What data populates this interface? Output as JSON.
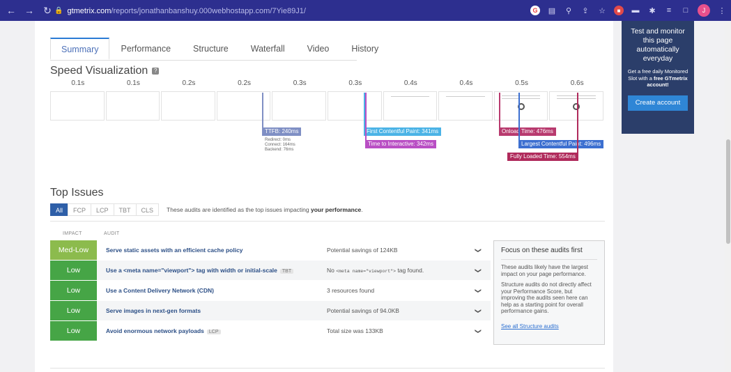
{
  "browser": {
    "url_host": "gtmetrix.com",
    "url_path": "/reports/jonathanbanshuy.000webhostapp.com/7Yie89J1/",
    "avatar_letter": "J"
  },
  "tabs": [
    {
      "label": "Summary"
    },
    {
      "label": "Performance"
    },
    {
      "label": "Structure"
    },
    {
      "label": "Waterfall"
    },
    {
      "label": "Video"
    },
    {
      "label": "History"
    }
  ],
  "speed": {
    "title": "Speed Visualization",
    "help": "?",
    "frame_times": [
      "0.1s",
      "0.1s",
      "0.2s",
      "0.2s",
      "0.3s",
      "0.3s",
      "0.4s",
      "0.4s",
      "0.5s",
      "0.6s"
    ],
    "ttfb": {
      "label": "TTFB: 240ms",
      "redirect": "Redirect: 0ms",
      "connect": "Connect: 164ms",
      "backend": "Backend: 76ms",
      "color": "#7f8fc4"
    },
    "fcp": {
      "label": "First Contentful Paint: 341ms",
      "color": "#4bb3e6"
    },
    "tti": {
      "label": "Time to Interactive: 342ms",
      "color": "#b94fc4"
    },
    "onload": {
      "label": "Onload Time: 476ms",
      "color": "#b83a6e"
    },
    "lcp": {
      "label": "Largest Contentful Paint: 496ms",
      "color": "#3c6fd0"
    },
    "fully_loaded": {
      "label": "Fully Loaded Time: 554ms",
      "color": "#b02a5b"
    }
  },
  "top_issues": {
    "title": "Top Issues",
    "filters": [
      "All",
      "FCP",
      "LCP",
      "TBT",
      "CLS"
    ],
    "filter_desc_prefix": "These audits are identified as the top issues impacting ",
    "filter_desc_bold": "your performance",
    "filter_desc_suffix": ".",
    "col_impact": "IMPACT",
    "col_audit": "AUDIT",
    "audits": [
      {
        "impact": "Med-Low",
        "title": "Serve static assets with an efficient cache policy",
        "tag": "",
        "result": "Potential savings of 124KB"
      },
      {
        "impact": "Low",
        "title": "Use a <meta name=\"viewport\"> tag with width or initial-scale",
        "tag": "TBT",
        "result_prefix": "No ",
        "result_code": "<meta name=\"viewport\">",
        "result_suffix": " tag found."
      },
      {
        "impact": "Low",
        "title": "Use a Content Delivery Network (CDN)",
        "tag": "",
        "result": "3 resources found"
      },
      {
        "impact": "Low",
        "title": "Serve images in next-gen formats",
        "tag": "",
        "result": "Potential savings of 94.0KB"
      },
      {
        "impact": "Low",
        "title": "Avoid enormous network payloads",
        "tag": "LCP",
        "result": "Total size was 133KB"
      }
    ],
    "focus": {
      "title": "Focus on these audits first",
      "text1": "These audits likely have the largest impact on your page performance.",
      "text2": "Structure audits do not directly affect your Performance Score, but improving the audits seen here can help as a starting point for overall performance gains.",
      "link": "See all Structure audits"
    }
  },
  "promo": {
    "headline": "Test and monitor this page automatically everyday",
    "text_pre": "Get a free daily Monitored Slot with a ",
    "text_bold": "free GTmetrix account!",
    "button": "Create account"
  }
}
